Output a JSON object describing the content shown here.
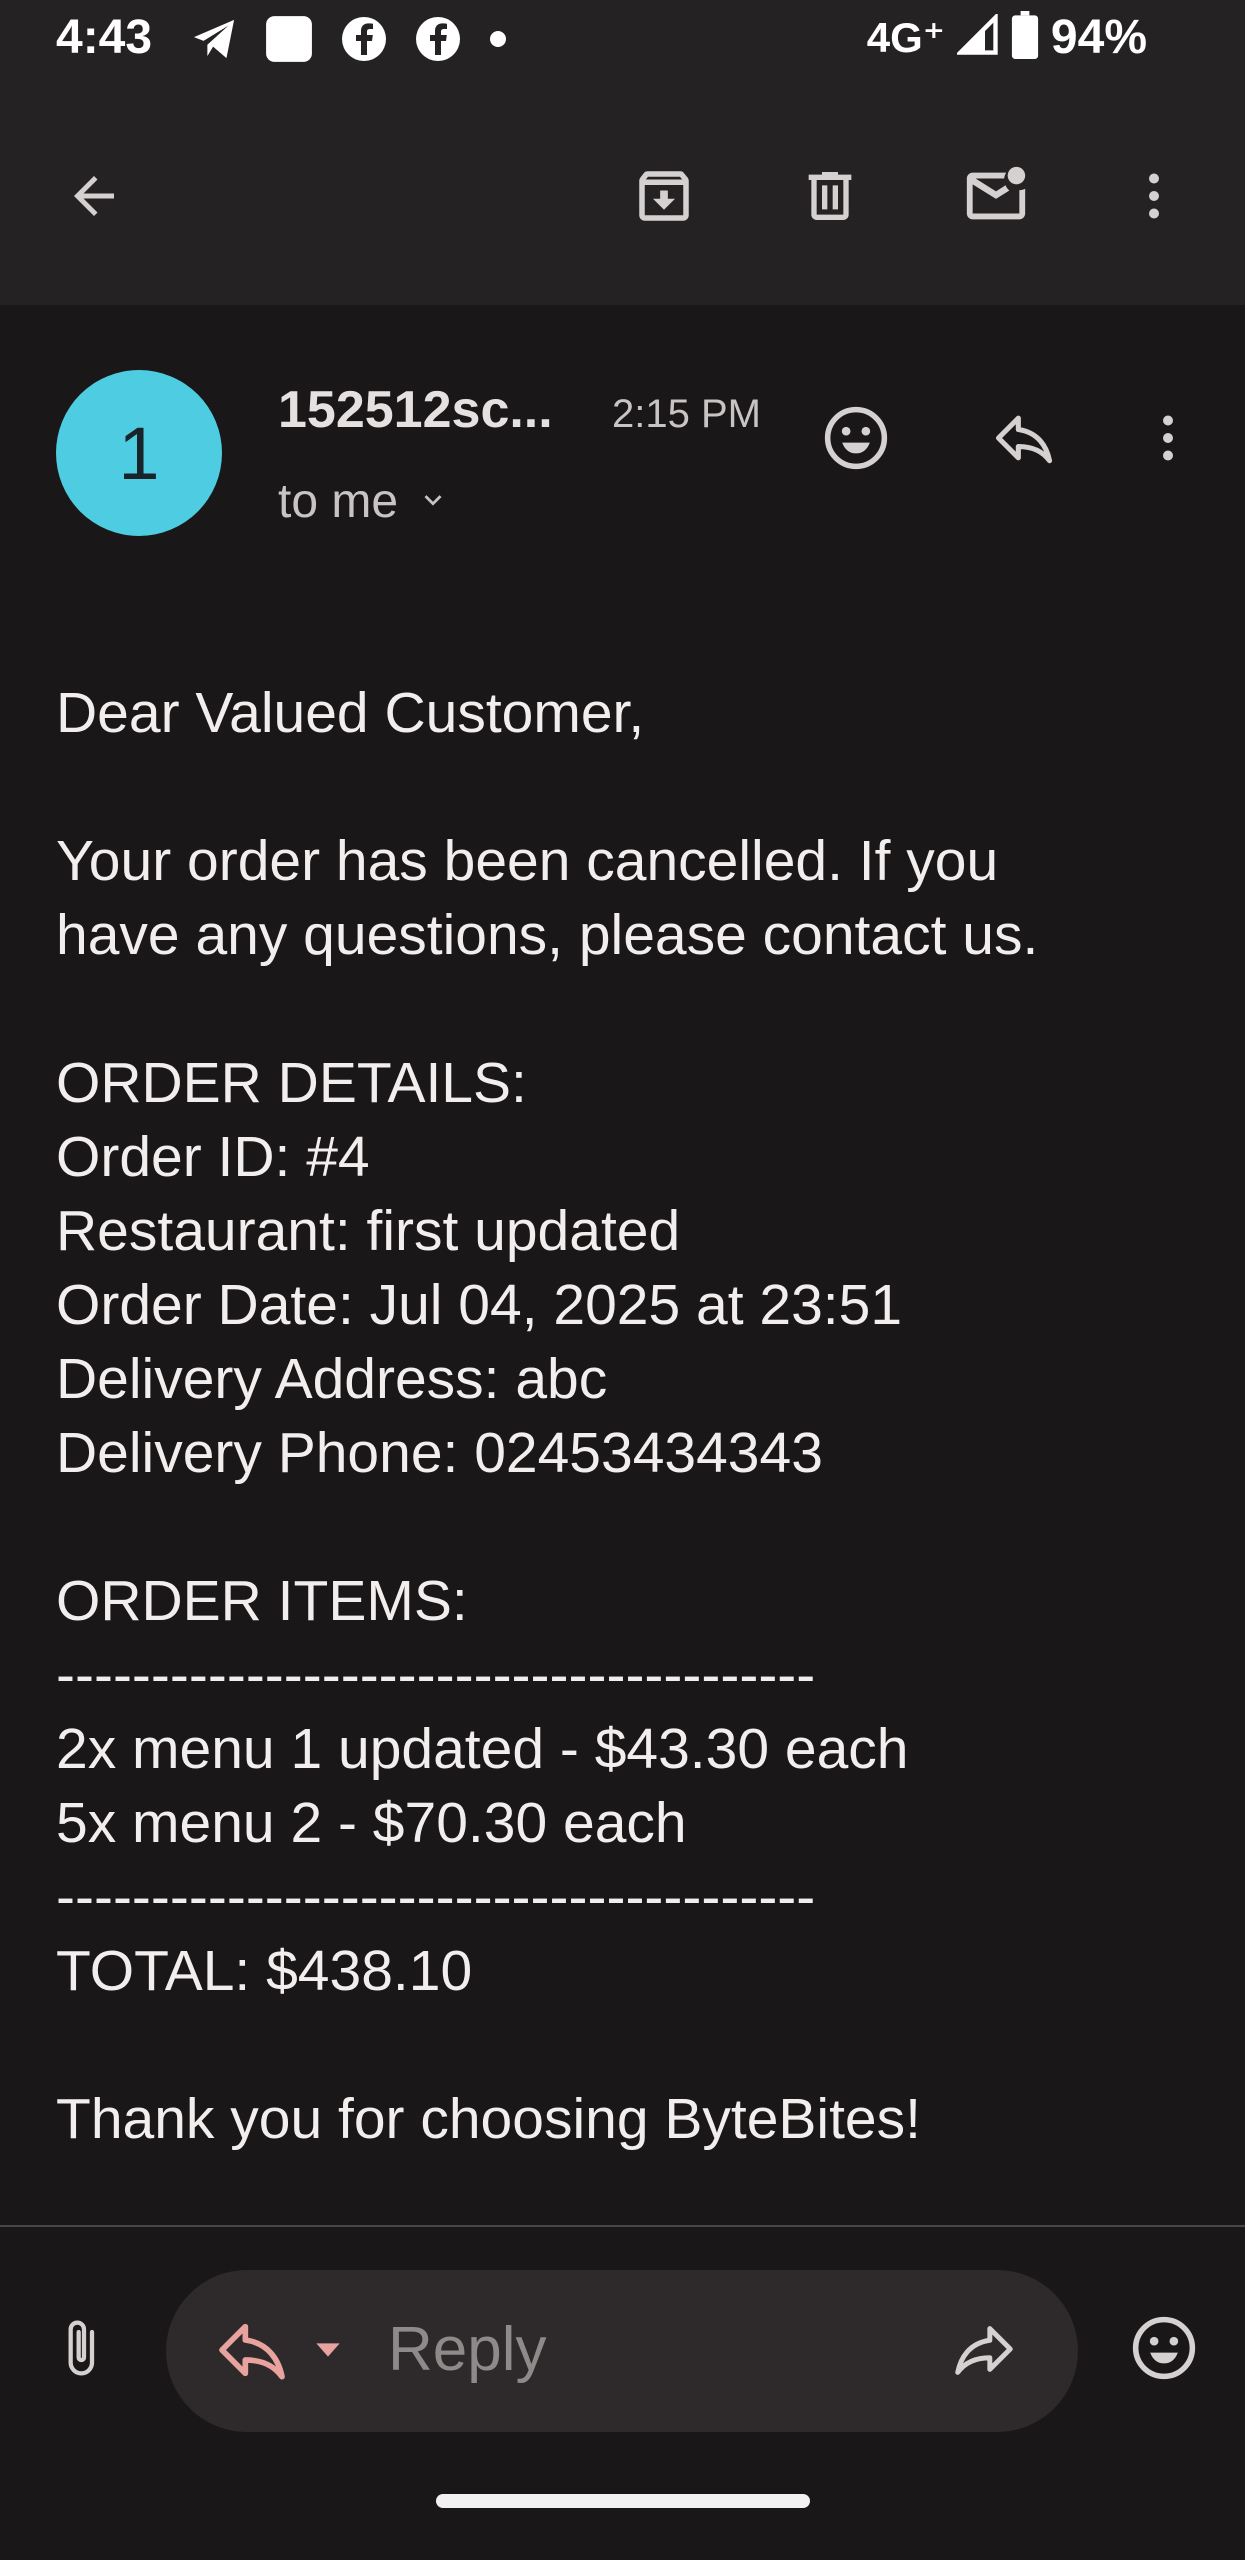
{
  "status_bar": {
    "time": "4:43",
    "network": "4G⁺",
    "battery": "94%"
  },
  "toolbar": {
    "icons": [
      "back-arrow-icon",
      "archive-icon",
      "delete-icon",
      "mark-unread-icon",
      "more-vert-icon"
    ]
  },
  "email": {
    "avatar_letter": "1",
    "avatar_color": "#4ecde2",
    "sender": "152512sc...",
    "time": "2:15 PM",
    "recipient": "to me",
    "body": {
      "greeting": "Dear Valued Customer,",
      "line1": "Your order has been cancelled. If you",
      "line2": "have any questions, please contact us.",
      "details_header": "ORDER DETAILS:",
      "order_id": "Order ID: #4",
      "restaurant": "Restaurant: first updated",
      "order_date": "Order Date: Jul 04, 2025 at 23:51",
      "address": "Delivery Address: abc",
      "phone": "Delivery Phone: 02453434343",
      "items_header": "ORDER ITEMS:",
      "separator": "----------------------------------------",
      "item1": "2x menu 1 updated - $43.30 each",
      "item2": "5x menu 2 - $70.30 each",
      "total": "TOTAL: $438.10",
      "closing": "Thank you for choosing ByteBites!"
    }
  },
  "reply_bar": {
    "placeholder": "Reply"
  }
}
